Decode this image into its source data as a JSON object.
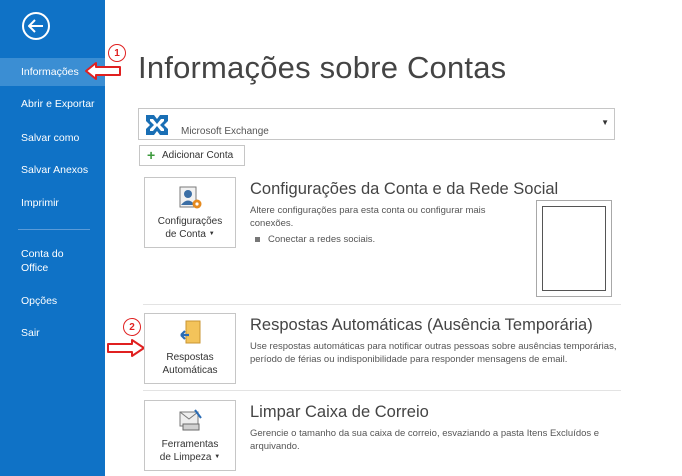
{
  "sidebar": {
    "back_icon": "back-arrow-icon",
    "items": [
      {
        "label": "Informações",
        "active": true
      },
      {
        "label": "Abrir e Exportar"
      },
      {
        "label": "Salvar como"
      },
      {
        "label": "Salvar Anexos"
      },
      {
        "label": "Imprimir"
      },
      {
        "label": "Conta do Office"
      },
      {
        "label": "Opções"
      },
      {
        "label": "Sair"
      }
    ]
  },
  "annotations": {
    "marker1": "1",
    "marker2": "2",
    "color": "#e02020"
  },
  "main": {
    "title": "Informações sobre Contas",
    "account": {
      "name": "Microsoft Exchange"
    },
    "add_account_label": "Adicionar Conta",
    "sections": [
      {
        "tile_label_1": "Configurações",
        "tile_label_2": "de Conta",
        "heading": "Configurações da Conta e da Rede Social",
        "description": "Altere configurações para esta conta ou configurar mais conexões.",
        "bullet": "Conectar a redes sociais."
      },
      {
        "tile_label_1": "Respostas",
        "tile_label_2": "Automáticas",
        "heading": "Respostas Automáticas (Ausência Temporária)",
        "description": "Use respostas automáticas para notificar outras pessoas sobre ausências temporárias, período de férias ou indisponibilidade para responder mensagens de email."
      },
      {
        "tile_label_1": "Ferramentas",
        "tile_label_2": "de Limpeza",
        "heading": "Limpar Caixa de Correio",
        "description": "Gerencie o tamanho da sua caixa de correio, esvaziando a pasta Itens Excluídos e arquivando."
      }
    ]
  },
  "colors": {
    "sidebar_bg": "#0f72c6",
    "sidebar_active": "#3b8ed3",
    "accent_red": "#e02020"
  }
}
